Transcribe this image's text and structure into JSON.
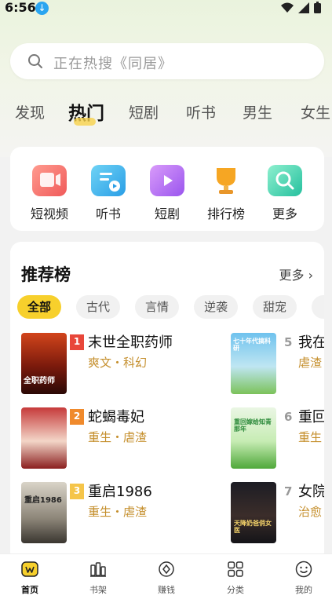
{
  "status_bar": {
    "time": "6:56"
  },
  "search": {
    "placeholder": "正在热搜《同居》"
  },
  "tabs": [
    "发现",
    "热门",
    "短剧",
    "听书",
    "男生",
    "女生"
  ],
  "shortcuts": [
    {
      "label": "短视频",
      "icon": "video-icon",
      "color": "#f36b6b"
    },
    {
      "label": "听书",
      "icon": "audiobook-icon",
      "color": "#3cb6e8"
    },
    {
      "label": "短剧",
      "icon": "short-drama-icon",
      "color": "#b46ef0"
    },
    {
      "label": "排行榜",
      "icon": "trophy-icon",
      "color": "#f4a531"
    },
    {
      "label": "更多",
      "icon": "more-search-icon",
      "color": "#3ccfb0"
    }
  ],
  "ranking": {
    "title": "推荐榜",
    "more": "更多",
    "chips": [
      "全部",
      "古代",
      "言情",
      "逆袭",
      "甜宠"
    ],
    "left_books": [
      {
        "rank": "1",
        "title": "末世全职药师",
        "meta": "爽文・科幻",
        "cover_text": "全职药师"
      },
      {
        "rank": "2",
        "title": "蛇蝎毒妃",
        "meta": "重生・虐渣",
        "cover_text": ""
      },
      {
        "rank": "3",
        "title": "重启1986",
        "meta": "重生・虐渣",
        "cover_text": "重启1986"
      }
    ],
    "right_books": [
      {
        "rank": "5",
        "title": "我在",
        "meta": "虐渣",
        "cover_text": "七十年代搞科研"
      },
      {
        "rank": "6",
        "title": "重回",
        "meta": "重生",
        "cover_text": "重回嫁给知青那年"
      },
      {
        "rank": "7",
        "title": "女院",
        "meta": "治愈",
        "cover_text": "天降奶爸俏女医"
      }
    ]
  },
  "bottom_nav": [
    "首页",
    "书架",
    "赚钱",
    "分类",
    "我的"
  ]
}
